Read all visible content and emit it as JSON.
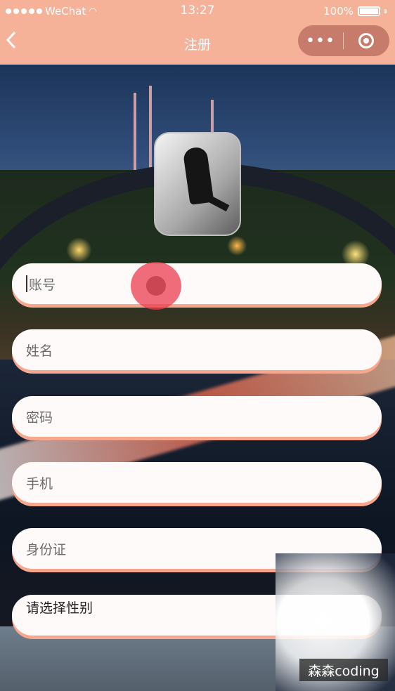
{
  "status_bar": {
    "carrier": "WeChat",
    "time": "13:27",
    "battery": "100%"
  },
  "nav": {
    "title": "注册",
    "more_label": "•••"
  },
  "form": {
    "account_placeholder": "账号",
    "name_placeholder": "姓名",
    "password_placeholder": "密码",
    "phone_placeholder": "手机",
    "id_card_placeholder": "身份证",
    "gender_picker_label": "请选择性别"
  },
  "watermark": "森森coding",
  "colors": {
    "accent": "#f6b199",
    "field_shadow": "#f6a78d",
    "touch_indicator": "#ec3c50"
  }
}
